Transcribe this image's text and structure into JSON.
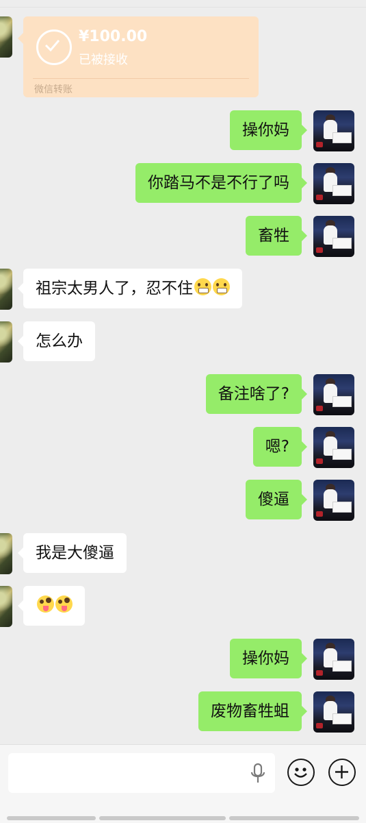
{
  "transfer": {
    "amount": "¥100.00",
    "status": "已被接收",
    "footer": "微信转账"
  },
  "messages": [
    {
      "side": "out",
      "text": "操你妈"
    },
    {
      "side": "out",
      "text": "你踏马不是不行了吗"
    },
    {
      "side": "out",
      "text": "畜牲"
    },
    {
      "side": "in",
      "text": "祖宗太男人了，忍不住"
    },
    {
      "side": "in",
      "text": "怎么办"
    },
    {
      "side": "out",
      "text": "备注啥了?"
    },
    {
      "side": "out",
      "text": "嗯?"
    },
    {
      "side": "out",
      "text": "傻逼"
    },
    {
      "side": "in",
      "text": "我是大傻逼"
    },
    {
      "side": "in",
      "text": ""
    },
    {
      "side": "out",
      "text": "操你妈"
    },
    {
      "side": "out",
      "text": "废物畜牲蛆"
    }
  ],
  "input": {
    "value": "",
    "placeholder": ""
  },
  "colors": {
    "outgoing_bubble": "#95ec69",
    "incoming_bubble": "#ffffff",
    "transfer_card": "#fde1c3",
    "background": "#ededed"
  },
  "icons": {
    "mic": "mic-icon",
    "emoji": "emoji-icon",
    "plus": "plus-icon",
    "transfer": "check-circle-icon"
  }
}
